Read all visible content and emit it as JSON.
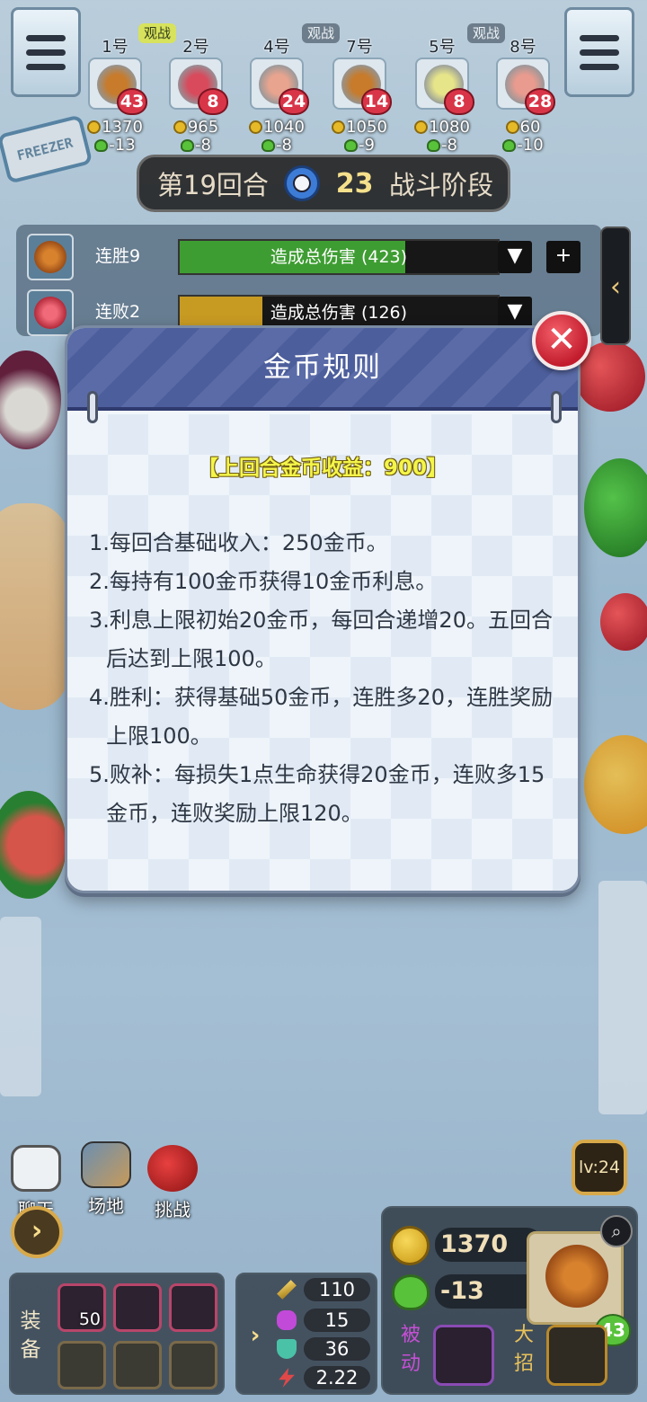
{
  "top_bar": {
    "spectate_labels": [
      "观战",
      "观战",
      "观战"
    ],
    "players": [
      {
        "num": "1号",
        "hp": "43",
        "coins": "1370",
        "delta": "-13",
        "color": "#c77b2b"
      },
      {
        "num": "2号",
        "hp": "8",
        "coins": "965",
        "delta": "-8",
        "color": "#d84a5c"
      },
      {
        "num": "4号",
        "hp": "24",
        "coins": "1040",
        "delta": "-8",
        "color": "#e8a48e"
      },
      {
        "num": "7号",
        "hp": "14",
        "coins": "1050",
        "delta": "-9",
        "color": "#c77b2b"
      },
      {
        "num": "5号",
        "hp": "8",
        "coins": "1080",
        "delta": "-8",
        "color": "#e7e58a"
      },
      {
        "num": "8号",
        "hp": "28",
        "coins": "60",
        "delta": "-10",
        "color": "#e89b8e"
      }
    ]
  },
  "round": {
    "label": "第19回合",
    "timer": "23",
    "phase": "战斗阶段"
  },
  "damage": {
    "rows": [
      {
        "label": "连胜9",
        "text": "造成总伤害 (423)",
        "fill": 0.71,
        "color": "#3e9d32"
      },
      {
        "label": "连败2",
        "text": "造成总伤害 (126)",
        "fill": 0.26,
        "color": "#c79a22"
      }
    ],
    "dropdown_glyph": "▼",
    "add_glyph": "+",
    "side_tab_glyph": "‹"
  },
  "modal": {
    "title": "金币规则",
    "summary": "【上回合金币收益：900】",
    "rules": [
      "1.每回合基础收入：250金币。",
      "2.每持有100金币获得10金币利息。",
      "3.利息上限初始20金币，每回合递增20。五回合后达到上限100。",
      "4.胜利：获得基础50金币，连胜多20，连胜奖励上限100。",
      "5.败补：每损失1点生命获得20金币，连败多15金币，连败奖励上限120。"
    ],
    "close_glyph": "✕"
  },
  "background": {
    "sign_text": "FREEZER"
  },
  "bottom": {
    "chat_label": "聊天",
    "field_label": "场地",
    "challenge_label": "挑战",
    "arrow_glyph": "›",
    "equip_label": "装备",
    "equip_count": "50",
    "stats": [
      "110",
      "15",
      "36",
      "2.22"
    ],
    "level": "lv:24",
    "coins": "1370",
    "hp_delta": "-13",
    "hero_hp": "43",
    "passive_label": "被动",
    "ultimate_label": "大招",
    "search_glyph": "⌕"
  }
}
